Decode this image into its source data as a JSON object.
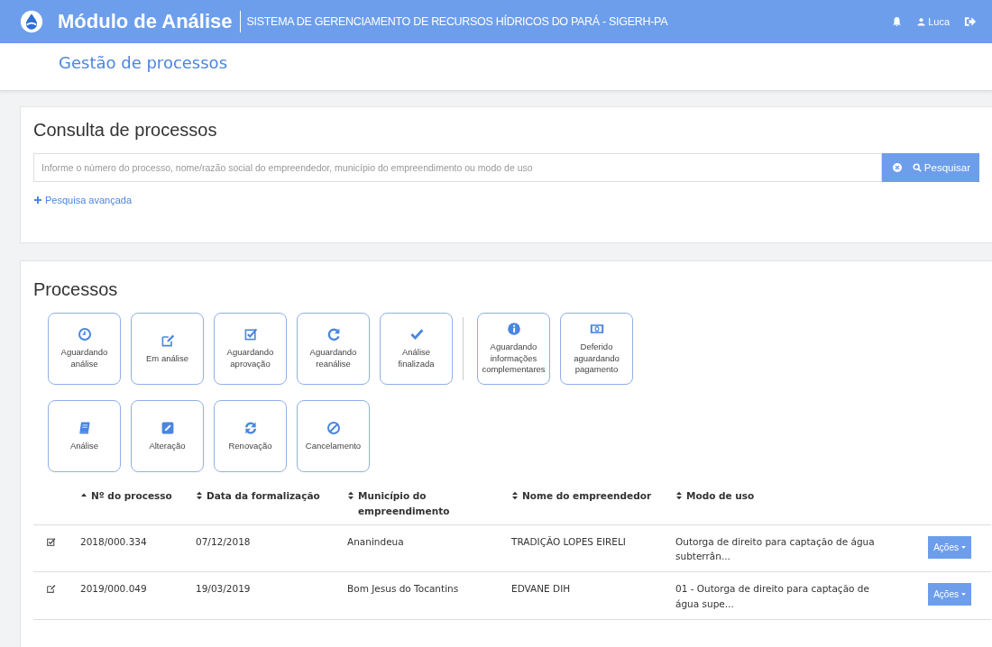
{
  "header": {
    "title": "Módulo de Análise",
    "subtitle": "SISTEMA DE GERENCIAMENTO DE RECURSOS HÍDRICOS DO PARÁ - SIGERH-PA",
    "user": "Luca"
  },
  "page_title": "Gestão de processos",
  "search_card": {
    "title": "Consulta de processos",
    "search": {
      "placeholder": "Informe o número do processo, nome/razão social do empreendedor, município do empreendimento ou modo de uso"
    },
    "search_button": "Pesquisar",
    "advanced_link": "Pesquisa avançada"
  },
  "processes_card": {
    "title": "Processos",
    "status_filters": [
      [
        {
          "label": "Aguardando análise"
        },
        {
          "label": "Em análise"
        },
        {
          "label": "Aguardando aprovação"
        },
        {
          "label": "Aguardando reanálise"
        },
        {
          "label": "Análise finalizada"
        }
      ],
      [
        {
          "label": "Aguardando informações complementares"
        },
        {
          "label": "Deferido aguardando pagamento"
        }
      ]
    ],
    "type_filters": [
      {
        "label": "Análise"
      },
      {
        "label": "Alteração"
      },
      {
        "label": "Renovação"
      },
      {
        "label": "Cancelamento"
      }
    ],
    "table": {
      "columns": [
        {
          "label": "Nº do processo",
          "sorted": true
        },
        {
          "label": "Data da formalização",
          "sorted": false
        },
        {
          "label": "Município do empreendimento",
          "sorted": false
        },
        {
          "label": "Nome do empreendedor",
          "sorted": false
        },
        {
          "label": "Modo de uso",
          "sorted": false
        }
      ],
      "rows": [
        {
          "cells": [
            "2018/000.334",
            "07/12/2018",
            "Ananindeua",
            "TRADIÇÃO LOPES EIRELI",
            "Outorga de direito para captação de água subterrân..."
          ],
          "action": "Ações"
        },
        {
          "cells": [
            "2019/000.049",
            "19/03/2019",
            "Bom Jesus do Tocantins",
            "EDVANE DIH",
            "01 - Outorga de direito para captação de água supe..."
          ],
          "action": "Ações"
        }
      ]
    }
  }
}
